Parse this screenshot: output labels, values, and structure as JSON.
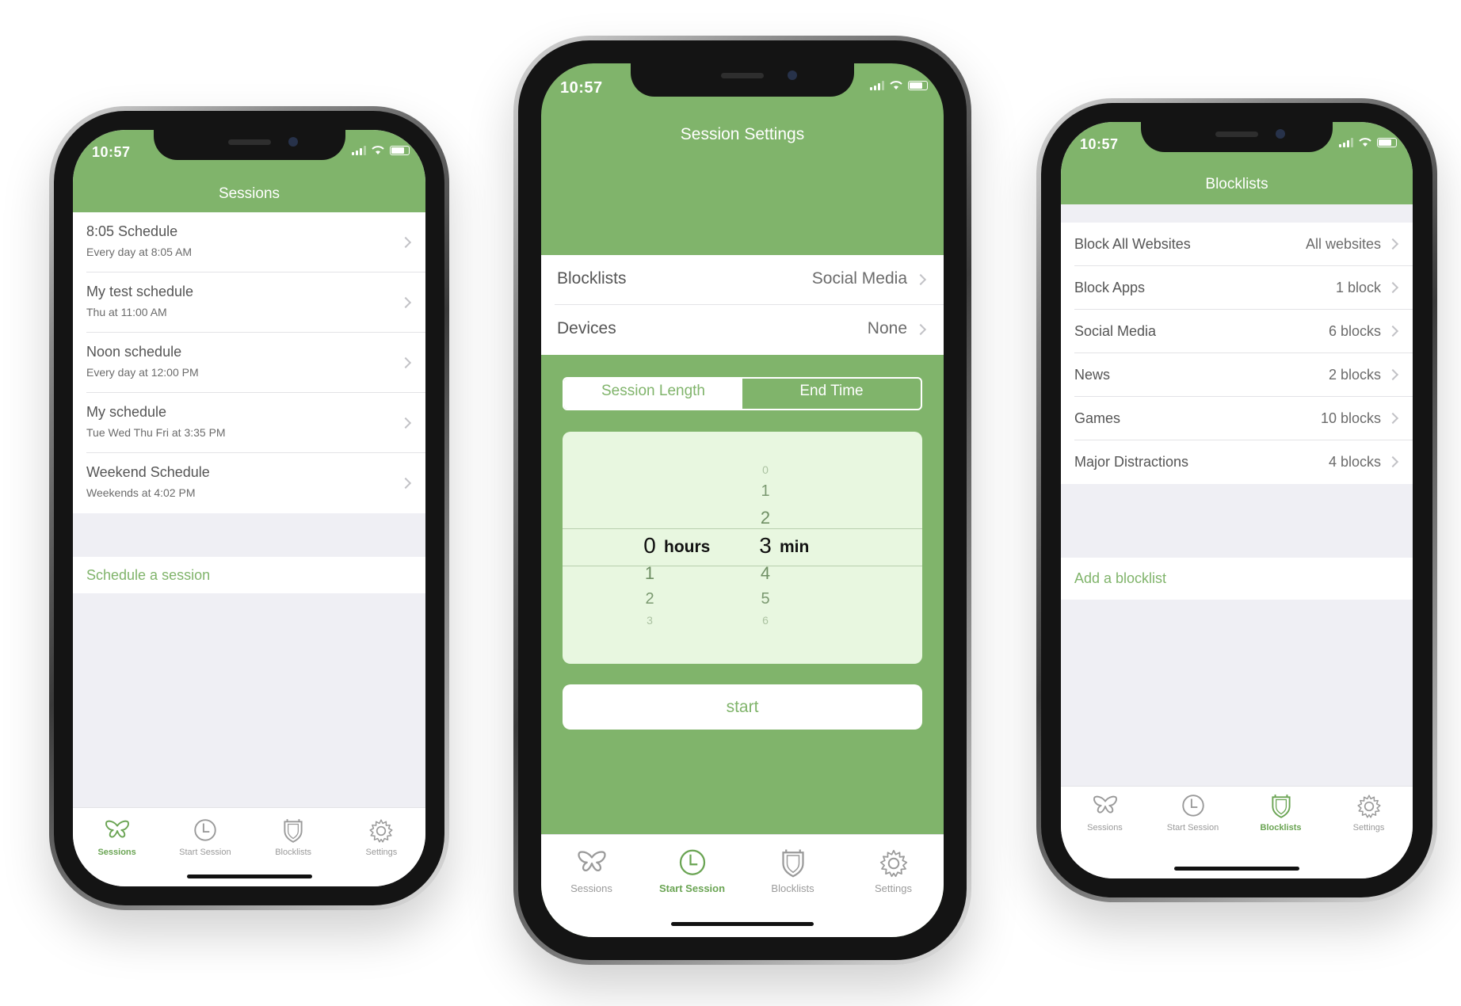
{
  "colors": {
    "accent": "#80b46b",
    "active_tab": "#6aa453",
    "background": "#efeff4"
  },
  "tabs": [
    {
      "label": "Sessions",
      "icon": "butterfly-icon"
    },
    {
      "label": "Start Session",
      "icon": "clock-icon"
    },
    {
      "label": "Blocklists",
      "icon": "shield-icon"
    },
    {
      "label": "Settings",
      "icon": "gear-icon"
    }
  ],
  "left_phone": {
    "time": "10:57",
    "title": "Sessions",
    "active_tab": 0,
    "sessions": [
      {
        "name": "8:05 Schedule",
        "detail": "Every day at 8:05 AM"
      },
      {
        "name": "My test schedule",
        "detail": "Thu at 11:00 AM"
      },
      {
        "name": "Noon schedule",
        "detail": "Every day at 12:00 PM"
      },
      {
        "name": "My schedule",
        "detail": "Tue Wed Thu Fri at 3:35 PM"
      },
      {
        "name": "Weekend Schedule",
        "detail": "Weekends at 4:02 PM"
      }
    ],
    "action": "Schedule a session"
  },
  "middle_phone": {
    "time": "10:57",
    "title": "Session Settings",
    "active_tab": 1,
    "settings": [
      {
        "label": "Blocklists",
        "value": "Social Media"
      },
      {
        "label": "Devices",
        "value": "None"
      }
    ],
    "segments": {
      "selected": "Session Length",
      "other": "End Time"
    },
    "picker": {
      "hours_above": [],
      "hours_selected": "0",
      "hours_unit": "hours",
      "hours_below": [
        "1",
        "2",
        "3"
      ],
      "minutes_above": [
        "0",
        "1",
        "2"
      ],
      "minutes_selected": "3",
      "minutes_unit": "min",
      "minutes_below": [
        "4",
        "5",
        "6"
      ]
    },
    "start_label": "start"
  },
  "right_phone": {
    "time": "10:57",
    "title": "Blocklists",
    "active_tab": 2,
    "blocklists": [
      {
        "name": "Block All Websites",
        "value": "All websites"
      },
      {
        "name": "Block Apps",
        "value": "1 block"
      },
      {
        "name": "Social Media",
        "value": "6 blocks"
      },
      {
        "name": "News",
        "value": "2 blocks"
      },
      {
        "name": "Games",
        "value": "10 blocks"
      },
      {
        "name": "Major Distractions",
        "value": "4 blocks"
      }
    ],
    "action": "Add a blocklist"
  }
}
